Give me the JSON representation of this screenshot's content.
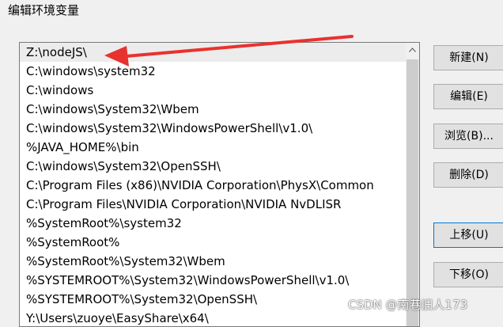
{
  "window": {
    "title": "编辑环境变量"
  },
  "paths": [
    "Z:\\nodeJS\\",
    "C:\\windows\\system32",
    "C:\\windows",
    "C:\\windows\\System32\\Wbem",
    "C:\\windows\\System32\\WindowsPowerShell\\v1.0\\",
    "%JAVA_HOME%\\bin",
    "C:\\windows\\System32\\OpenSSH\\",
    "C:\\Program Files (x86)\\NVIDIA Corporation\\PhysX\\Common",
    "C:\\Program Files\\NVIDIA Corporation\\NVIDIA NvDLISR",
    "%SystemRoot%\\system32",
    "%SystemRoot%",
    "%SystemRoot%\\System32\\Wbem",
    "%SYSTEMROOT%\\System32\\WindowsPowerShell\\v1.0\\",
    "%SYSTEMROOT%\\System32\\OpenSSH\\",
    "Y:\\Users\\zuoye\\EasyShare\\x64\\"
  ],
  "buttons": {
    "new": "新建(N)",
    "edit": "编辑(E)",
    "browse": "浏览(B)...",
    "delete": "删除(D)",
    "move_up": "上移(U)",
    "move_down": "下移(O)"
  },
  "watermark": "CSDN @南巷旧人173",
  "colors": {
    "annotation_arrow": "#e8322f",
    "focus_border": "#0078d7"
  }
}
